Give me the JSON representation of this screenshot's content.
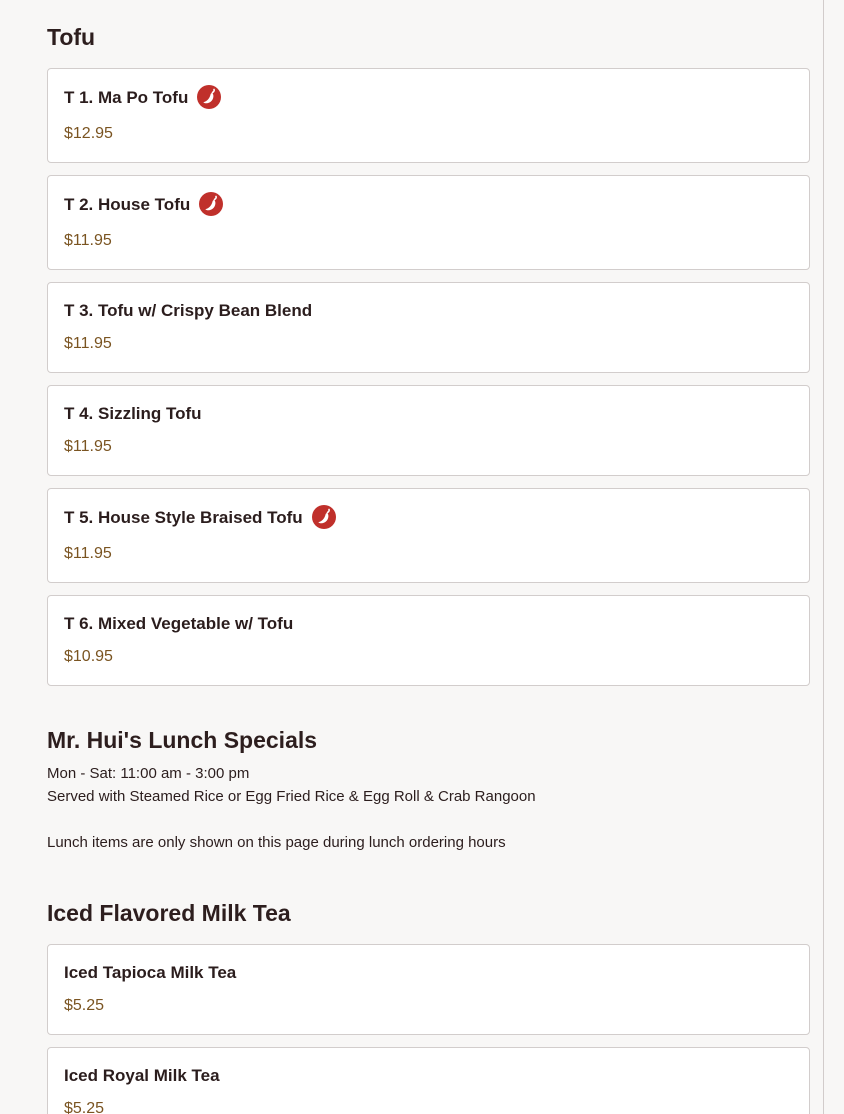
{
  "sections": {
    "tofu": {
      "title": "Tofu",
      "items": [
        {
          "name": "T 1. Ma Po Tofu",
          "price": "$12.95",
          "spicy": true
        },
        {
          "name": "T 2. House Tofu",
          "price": "$11.95",
          "spicy": true
        },
        {
          "name": "T 3. Tofu w/ Crispy Bean Blend",
          "price": "$11.95",
          "spicy": false
        },
        {
          "name": "T 4. Sizzling Tofu",
          "price": "$11.95",
          "spicy": false
        },
        {
          "name": "T 5. House Style Braised Tofu",
          "price": "$11.95",
          "spicy": true
        },
        {
          "name": "T 6. Mixed Vegetable w/ Tofu",
          "price": "$10.95",
          "spicy": false
        }
      ]
    },
    "lunch": {
      "title": "Mr. Hui's Lunch Specials",
      "hours": "Mon - Sat: 11:00 am - 3:00 pm",
      "served_with": "Served with Steamed Rice or Egg Fried Rice & Egg Roll & Crab Rangoon",
      "notice": "Lunch items are only shown on this page during lunch ordering hours"
    },
    "milk_tea": {
      "title": "Iced Flavored Milk Tea",
      "items": [
        {
          "name": "Iced Tapioca Milk Tea",
          "price": "$5.25",
          "spicy": false
        },
        {
          "name": "Iced Royal Milk Tea",
          "price": "$5.25",
          "spicy": false
        }
      ]
    }
  },
  "icons": {
    "spicy": "spicy-pepper-icon"
  },
  "colors": {
    "price": "#7a5421",
    "spicy_badge": "#c0302b",
    "background": "#f8f7f6"
  }
}
